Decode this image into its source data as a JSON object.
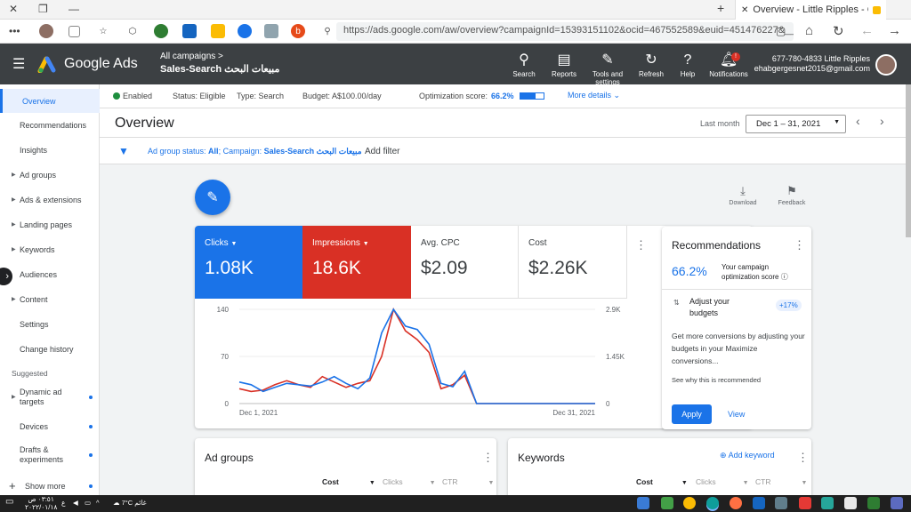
{
  "browser": {
    "tab_title": "Overview - Little Ripples - Goog",
    "url": "https://ads.google.com/aw/overview?campaignId=15393151102&ocid=467552589&euid=451476227&__u="
  },
  "app": {
    "product": "Google Ads",
    "breadcrumb_parent": "All campaigns",
    "breadcrumb_current": "Sales-Search مبيعات البحث",
    "tools": [
      "Search",
      "Reports",
      "Tools and settings",
      "Refresh",
      "Help",
      "Notifications"
    ],
    "notification_badge": "!",
    "account_id": "677-780-4833 Little Ripples",
    "account_email": "ehabgergesnet2015@gmail.com"
  },
  "sidebar": {
    "items": [
      "Overview",
      "Recommendations",
      "Insights",
      "Ad groups",
      "Ads & extensions",
      "Landing pages",
      "Keywords",
      "Audiences",
      "Content",
      "Settings",
      "Change history"
    ],
    "suggested_label": "Suggested",
    "suggested": [
      "Dynamic ad targets",
      "Devices",
      "Drafts & experiments"
    ],
    "show_more": "Show more"
  },
  "status": {
    "enabled": "Enabled",
    "status": "Status: Eligible",
    "type": "Type: Search",
    "budget": "Budget: A$100.00/day",
    "opt_label": "Optimization score:",
    "opt_value": "66.2%",
    "opt_fraction": 0.662,
    "more": "More details"
  },
  "page": {
    "title": "Overview",
    "date_label": "Last month",
    "date_range": "Dec 1 – 31, 2021"
  },
  "filter": {
    "text_prefix": "Ad group status: ",
    "text_bold": "All",
    "text_mid": "; Campaign: ",
    "text_campaign": "Sales-Search مبيعات البحث",
    "add": "Add filter"
  },
  "actions": {
    "download": "Download",
    "feedback": "Feedback"
  },
  "metrics": [
    {
      "label": "Clicks",
      "value": "1.08K",
      "color": "#1a73e8"
    },
    {
      "label": "Impressions",
      "value": "18.6K",
      "color": "#d93025"
    },
    {
      "label": "Avg. CPC",
      "value": "$2.09"
    },
    {
      "label": "Cost",
      "value": "$2.26K"
    }
  ],
  "chart_data": {
    "type": "line",
    "x": [
      "Dec 1",
      "Dec 2",
      "Dec 3",
      "Dec 4",
      "Dec 5",
      "Dec 6",
      "Dec 7",
      "Dec 8",
      "Dec 9",
      "Dec 10",
      "Dec 11",
      "Dec 12",
      "Dec 13",
      "Dec 14",
      "Dec 15",
      "Dec 16",
      "Dec 17",
      "Dec 18",
      "Dec 19",
      "Dec 20",
      "Dec 21",
      "Dec 22",
      "Dec 23",
      "Dec 24",
      "Dec 25",
      "Dec 26",
      "Dec 27",
      "Dec 28",
      "Dec 29",
      "Dec 30",
      "Dec 31"
    ],
    "series": [
      {
        "name": "Clicks",
        "color": "#1a73e8",
        "values": [
          32,
          28,
          18,
          24,
          30,
          28,
          26,
          32,
          40,
          30,
          22,
          38,
          105,
          140,
          115,
          110,
          88,
          30,
          25,
          48,
          0,
          0,
          0,
          0,
          0,
          0,
          0,
          0,
          0,
          0,
          0
        ]
      },
      {
        "name": "Impressions",
        "color": "#d93025",
        "values": [
          22,
          18,
          20,
          28,
          34,
          28,
          24,
          40,
          32,
          24,
          30,
          34,
          70,
          140,
          108,
          95,
          76,
          22,
          28,
          42,
          0,
          0,
          0,
          0,
          0,
          0,
          0,
          0,
          0,
          0,
          0
        ]
      }
    ],
    "left_ticks": [
      "140",
      "70",
      "0"
    ],
    "right_ticks": [
      "2.9K",
      "1.45K",
      "0"
    ],
    "x_start": "Dec 1, 2021",
    "x_end": "Dec 31, 2021",
    "ylim": [
      0,
      140
    ]
  },
  "recommendations": {
    "title": "Recommendations",
    "score": "66.2%",
    "score_label": "Your campaign optimization score",
    "item_title": "Adjust your budgets",
    "item_uplift": "+17%",
    "body": "Get more conversions by adjusting your budgets in your Maximize conversions...",
    "why": "See why this is recommended",
    "apply": "Apply",
    "view": "View"
  },
  "ad_groups": {
    "title": "Ad groups",
    "cols": [
      "Cost",
      "Clicks",
      "CTR"
    ]
  },
  "keywords": {
    "title": "Keywords",
    "add": "Add keyword",
    "cols": [
      "Cost",
      "Clicks",
      "CTR"
    ]
  },
  "taskbar": {
    "time": "٠٣:٥١ ص",
    "date": "٢٠٢٢/٠١/١٨",
    "lang": "ع",
    "weather": "7°C غائم"
  }
}
